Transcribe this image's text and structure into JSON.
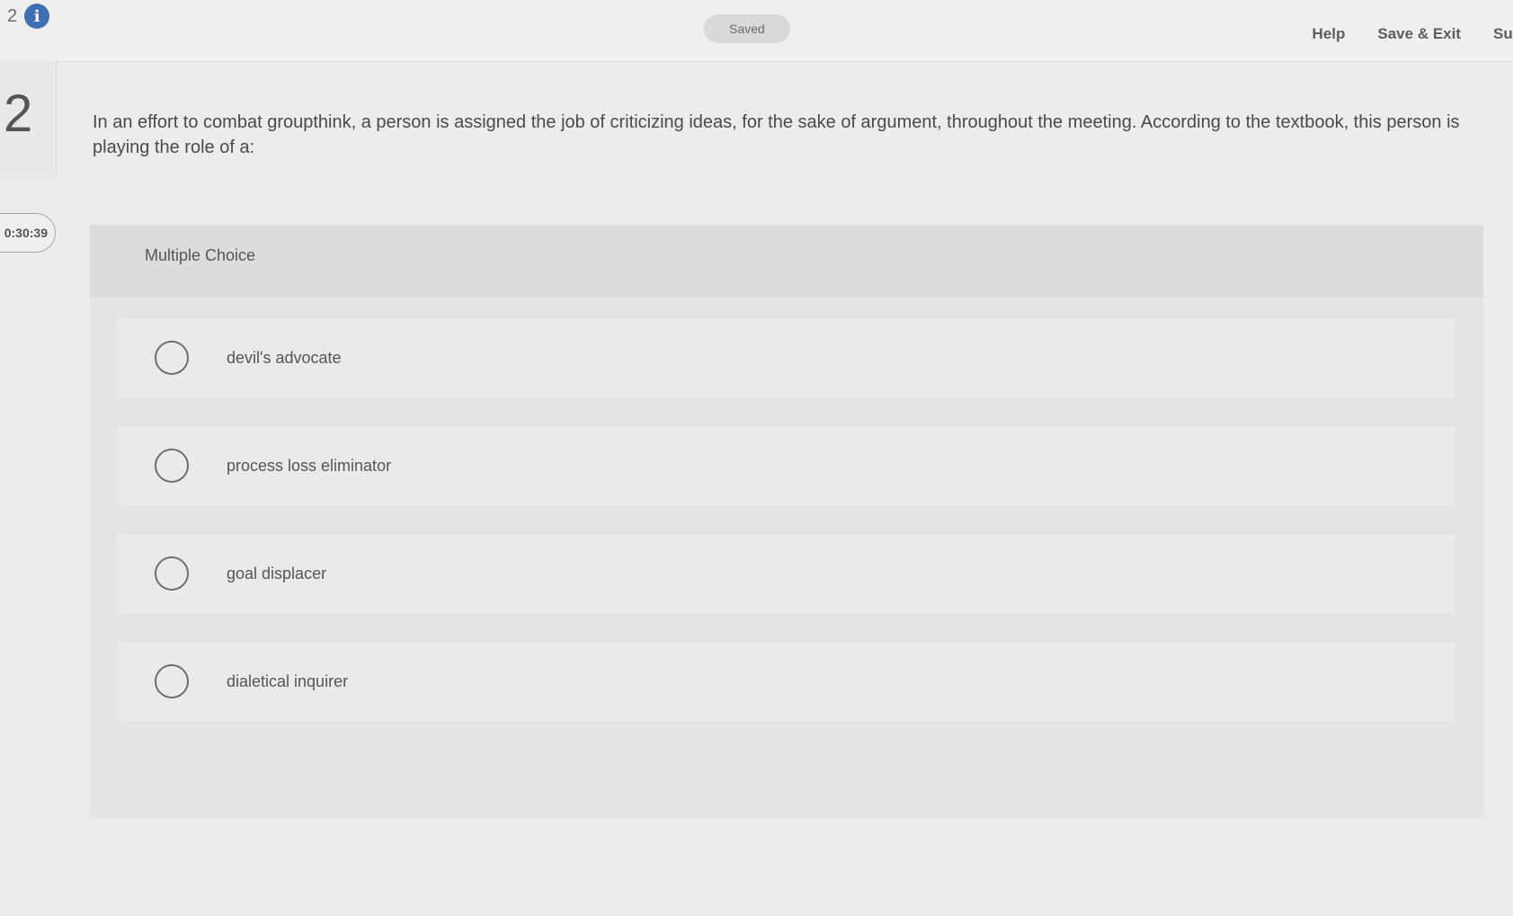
{
  "header": {
    "question_number": "2",
    "saved_label": "Saved",
    "help_label": "Help",
    "save_exit_label": "Save & Exit",
    "submit_label": "Sub"
  },
  "sidebar": {
    "question_number": "2",
    "timer": "0:30:39"
  },
  "question": {
    "text": "In an effort to combat groupthink, a person is assigned the job of criticizing ideas, for the sake of argument, throughout the meeting.  According to the textbook, this person is playing the role of a:"
  },
  "answer_card": {
    "type_label": "Multiple Choice",
    "choices": [
      {
        "label": "devil's advocate"
      },
      {
        "label": "process loss eliminator"
      },
      {
        "label": "goal displacer"
      },
      {
        "label": "dialetical inquirer"
      }
    ]
  },
  "icons": {
    "info": "info-icon",
    "radio": "radio-unchecked-icon"
  },
  "colors": {
    "info_icon": "#3f6fb3",
    "background": "#ececea"
  }
}
